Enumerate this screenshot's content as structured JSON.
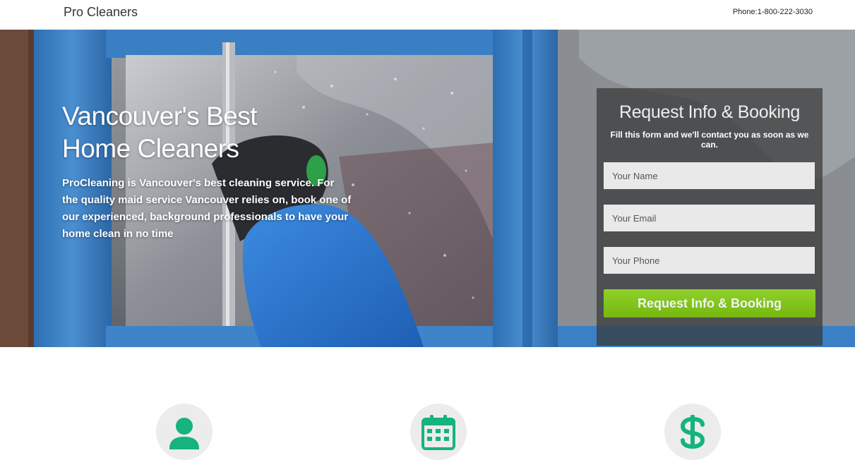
{
  "header": {
    "brand": "Pro Cleaners",
    "phone": "Phone:1-800-222-3030"
  },
  "hero": {
    "title_line1": "Vancouver's Best",
    "title_line2": "Home Cleaners",
    "text": "ProCleaning is Vancouver's best cleaning service. For the quality maid service Vancouver relies on, book one of our experienced, background professionals to have your home clean in no time"
  },
  "form": {
    "title": "Request Info & Booking",
    "subtitle": "Fill this form and we'll contact you as soon as we can.",
    "name_placeholder": "Your Name",
    "email_placeholder": "Your Email",
    "phone_placeholder": "Your Phone",
    "submit_label": "Request Info & Booking"
  },
  "features": [
    {
      "icon": "user-icon"
    },
    {
      "icon": "calendar-icon"
    },
    {
      "icon": "dollar-icon"
    }
  ],
  "colors": {
    "accent_green": "#7cc11a",
    "icon_teal": "#15b37e"
  }
}
